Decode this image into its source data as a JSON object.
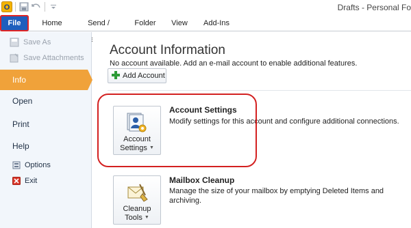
{
  "window": {
    "title": "Drafts - Personal Fo"
  },
  "ribbon": {
    "tabs": [
      {
        "id": "file",
        "label": "File"
      },
      {
        "id": "home",
        "label": "Home"
      },
      {
        "id": "send_receive",
        "label": "Send / Receive"
      },
      {
        "id": "folder",
        "label": "Folder"
      },
      {
        "id": "view",
        "label": "View"
      },
      {
        "id": "addins",
        "label": "Add-Ins"
      }
    ]
  },
  "nav": {
    "save_as": "Save As",
    "save_attachments": "Save Attachments",
    "info": "Info",
    "open": "Open",
    "print": "Print",
    "help": "Help",
    "options": "Options",
    "exit": "Exit"
  },
  "main": {
    "title": "Account Information",
    "subtitle": "No account available. Add an e-mail account to enable additional features.",
    "add_account_label": "Add Account",
    "account_settings": {
      "button_line1": "Account",
      "button_line2": "Settings",
      "title": "Account Settings",
      "description": "Modify settings for this account and configure additional connections."
    },
    "mailbox_cleanup": {
      "button_line1": "Cleanup",
      "button_line2": "Tools",
      "title": "Mailbox Cleanup",
      "description_line1": "Manage the size of your mailbox by emptying Deleted Items and",
      "description_line2": "archiving."
    }
  },
  "colors": {
    "file_tab": "#1e5ebd",
    "info_highlight": "#f0a23a",
    "annotation": "#d32020"
  },
  "icons": {
    "app": "outlook-icon",
    "save": "save-icon",
    "undo": "undo-icon",
    "customize": "qat-customize-icon",
    "add": "plus-icon",
    "account_settings": "account-settings-icon",
    "cleanup": "cleanup-tools-icon",
    "options": "options-icon",
    "exit": "exit-icon"
  }
}
